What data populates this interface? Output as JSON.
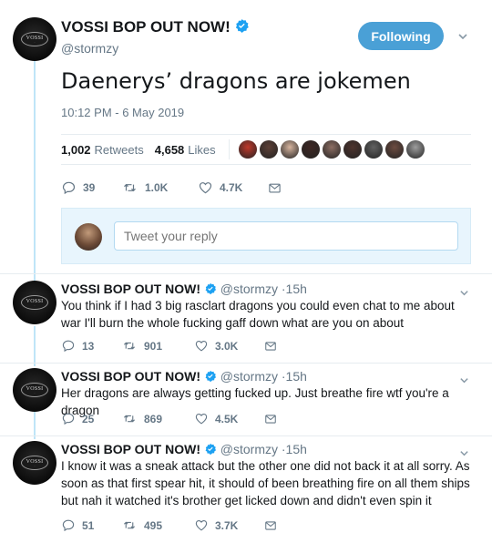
{
  "tweet": {
    "name": "VOSSI BOP OUT NOW!",
    "handle": "@stormzy",
    "follow_label": "Following",
    "text": "Daenerys’ dragons are jokemen",
    "timestamp": "10:12 PM - 6 May 2019",
    "retweets_count": "1,002",
    "retweets_label": "Retweets",
    "likes_count": "4,658",
    "likes_label": "Likes",
    "replies": "39",
    "retweet_action": "1.0K",
    "like_action": "4.7K",
    "avatar_text": "VOSSI",
    "likers": [
      "#c0392b",
      "#5d4037",
      "#d7b49e",
      "#3e2723",
      "#8d6e63",
      "#4e342e",
      "#616161",
      "#6d4c41",
      "#9e9e9e"
    ]
  },
  "reply_box": {
    "placeholder": "Tweet your reply"
  },
  "replies": [
    {
      "name": "VOSSI BOP OUT NOW!",
      "handle": "@stormzy",
      "time": "·15h",
      "text": "You think if I had 3 big rasclart dragons you could even chat to me about war I'll burn the whole fucking gaff down what are you on about",
      "replies": "13",
      "retweets": "901",
      "likes": "3.0K"
    },
    {
      "name": "VOSSI BOP OUT NOW!",
      "handle": "@stormzy",
      "time": "·15h",
      "text": "Her dragons are always getting fucked up. Just breathe fire wtf you're a dragon",
      "replies": "25",
      "retweets": "869",
      "likes": "4.5K"
    },
    {
      "name": "VOSSI BOP OUT NOW!",
      "handle": "@stormzy",
      "time": "·15h",
      "text": "I know it was a sneak attack but the other one did not back it at all sorry. As soon as that first spear hit, it should of been breathing fire on all them ships but nah it watched it's brother get licked down and didn't even spin it",
      "replies": "51",
      "retweets": "495",
      "likes": "3.7K"
    }
  ],
  "colors": {
    "accent": "#1da1f2",
    "follow_button": "#4aa0d6",
    "thread_line": "#bfe5f8",
    "muted": "#657786"
  }
}
